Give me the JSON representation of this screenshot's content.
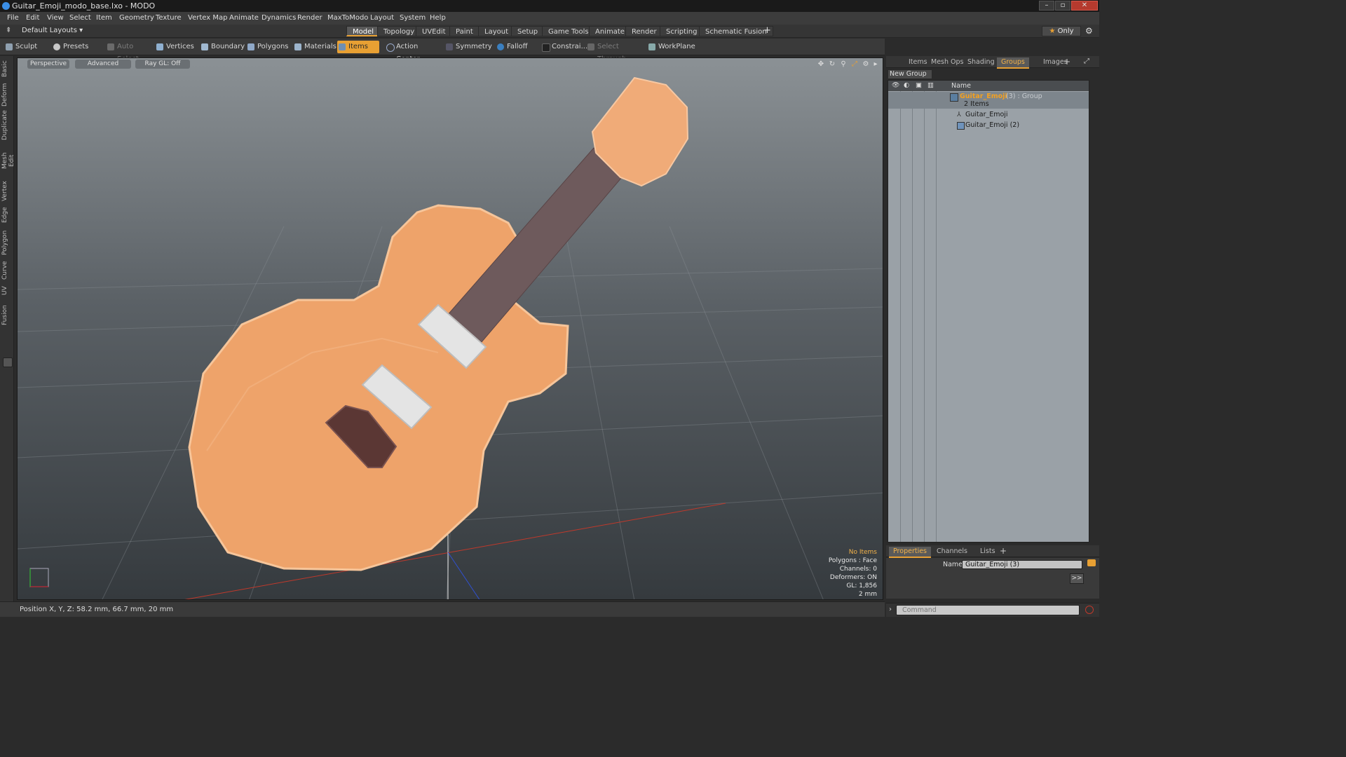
{
  "window": {
    "title": "Guitar_Emoji_modo_base.lxo - MODO"
  },
  "menu": [
    "File",
    "Edit",
    "View",
    "Select",
    "Item",
    "Geometry",
    "Texture",
    "Vertex Map",
    "Animate",
    "Dynamics",
    "Render",
    "MaxToModo",
    "Layout",
    "System",
    "Help"
  ],
  "layout_bar": {
    "layouts_label": "Default Layouts",
    "tabs": [
      "Model",
      "Topology",
      "UVEdit",
      "Paint",
      "Layout",
      "Setup",
      "Game Tools",
      "Animate",
      "Render",
      "Scripting",
      "Schematic Fusion"
    ],
    "active_tab": "Model",
    "only_label": "Only"
  },
  "toolbar": {
    "sculpt": "Sculpt",
    "presets": "Presets",
    "auto_select": "Auto Select",
    "vertices": "Vertices",
    "boundary": "Boundary",
    "polygons": "Polygons",
    "materials": "Materials",
    "items": "Items",
    "action_center": "Action Center",
    "symmetry": "Symmetry",
    "falloff": "Falloff",
    "constraints": "Constrai...",
    "select_through": "Select Through",
    "workplane": "WorkPlane"
  },
  "left_tabs": [
    "Basic",
    "Deform",
    "Duplicate",
    "Mesh Edit",
    "Vertex",
    "Edge",
    "Polygon",
    "Curve",
    "UV",
    "Fusion"
  ],
  "viewport": {
    "view_mode": "Perspective",
    "advanced": "Advanced",
    "ray_gl": "Ray GL: Off",
    "stats": {
      "selection": "No Items",
      "polygons": "Polygons : Face",
      "channels": "Channels: 0",
      "deformers": "Deformers: ON",
      "gl": "GL: 1,856",
      "grid": "2 mm"
    }
  },
  "status": {
    "position": "Position X, Y, Z:   58.2 mm, 66.7 mm, 20 mm"
  },
  "right_tabs": [
    "Items",
    "Mesh Ops",
    "Shading",
    "Groups",
    "Images"
  ],
  "right_active_tab": "Groups",
  "groups": {
    "new_group": "New Group",
    "column_name": "Name",
    "group_name": "Guitar_Emoji",
    "group_suffix": "(3) : Group",
    "group_count": "2 Items",
    "children": [
      "Guitar_Emoji",
      "Guitar_Emoji (2)"
    ]
  },
  "properties": {
    "tabs": [
      "Properties",
      "Channels",
      "Lists"
    ],
    "active_tab": "Properties",
    "name_label": "Name",
    "name_value": "Guitar_Emoji (3)",
    "expand": ">>"
  },
  "command": {
    "placeholder": "Command"
  },
  "colors": {
    "accent": "#e8a033",
    "body": "#eea36a",
    "neck": "#6e5a5c",
    "pickup": "#e4e4e4",
    "knob": "#5b3734"
  }
}
